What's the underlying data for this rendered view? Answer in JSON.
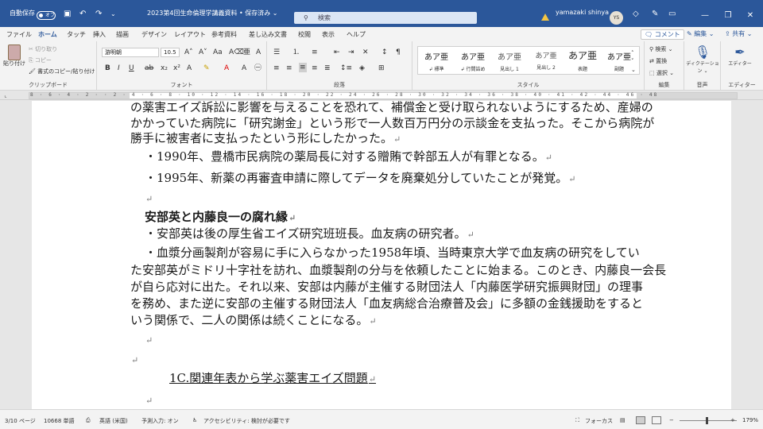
{
  "title_bar": {
    "autosave_label": "自動保存",
    "autosave_state": "オフ",
    "doc_title": "2023第4回生命倫理学講義資料 • 保存済み ⌄",
    "search_placeholder": "検索",
    "user_name": "yamazaki shinya",
    "user_initials": "YS"
  },
  "menu_tabs": [
    "ファイル",
    "ホーム",
    "タッチ",
    "挿入",
    "描画",
    "デザイン",
    "レイアウト",
    "参考資料",
    "差し込み文書",
    "校閲",
    "表示",
    "ヘルプ"
  ],
  "active_tab": "ホーム",
  "tab_right": {
    "comment": "コメント",
    "edit": "編集 ⌄",
    "share": "共有 ⌄"
  },
  "ribbon": {
    "clipboard": {
      "paste": "貼り付け",
      "cut": "切り取り",
      "copy": "コピー",
      "format_painter": "書式のコピー/貼り付け",
      "label": "クリップボード"
    },
    "font": {
      "font_name": "游明朝",
      "font_size": "10.5",
      "label": "フォント"
    },
    "paragraph": {
      "label": "段落"
    },
    "styles": {
      "items": [
        {
          "preview": "あア亜",
          "name": "標準"
        },
        {
          "preview": "あア亜",
          "name": "行間詰め"
        },
        {
          "preview": "あア亜",
          "name": "見出し 1"
        },
        {
          "preview": "あア亜",
          "name": "見出し 2"
        },
        {
          "preview": "あア亜",
          "name": "表題"
        },
        {
          "preview": "あア亜",
          "name": "副題"
        }
      ],
      "label": "スタイル"
    },
    "editing": {
      "find": "検索 ⌄",
      "replace": "置換",
      "select": "選択 ⌄",
      "label": "編集"
    },
    "voice": {
      "dictate": "ディクテーション ⌄",
      "label": "音声"
    },
    "editor": {
      "editor": "エディター",
      "label": "エディター"
    }
  },
  "ruler": {
    "numbers": "8 · 6 · 4 · 2 · · 2 · 4 · 6 · 8 · 10 · 12 · 14 · 16 · 18 · 20 · 22 · 24 · 26 · 28 · 30 · 32 · 34 · 36 · 38 · 40 · 41 · 42 · 44 · 46 · 48"
  },
  "document": {
    "lines": [
      "の薬害エイズ訴訟に影響を与えることを恐れて、補償金と受け取られないようにするため、産婦の",
      "かかっていた病院に「研究謝金」という形で一人数百万円分の示談金を支払った。そこから病院が",
      "勝手に被害者に支払ったという形にしたかった。",
      "・1990年、豊橋市民病院の薬局長に対する贈賄で幹部五人が有罪となる。",
      "・1995年、新薬の再審査申請に際してデータを廃棄処分していたことが発覚。",
      "",
      "安部英と内藤良一の腐れ縁",
      "・安部英は後の厚生省エイズ研究班班長。血友病の研究者。",
      "・血漿分画製剤が容易に手に入らなかった1958年頃、当時東京大学で血友病の研究をしてい",
      "た安部英がミドリ十字社を訪れ、血漿製剤の分与を依頼したことに始まる。このとき、内藤良一会長",
      "が自ら応対に出た。それ以来、安部は内藤が主催する財団法人「内藤医学研究振興財団」の理事",
      "を務め、また逆に安部の主催する財団法人「血友病総合治療普及会」に多額の金銭援助をすると",
      "いう関係で、二人の関係は続くことになる。",
      "",
      "",
      "1C.関連年表から学ぶ薬害エイズ問題",
      ""
    ]
  },
  "status_bar": {
    "page": "3/10 ページ",
    "words": "10668 単語",
    "language": "英語 (米国)",
    "prediction": "予測入力: オン",
    "accessibility": "アクセシビリティ: 検討が必要です",
    "focus": "フォーカス",
    "zoom": "179%"
  }
}
